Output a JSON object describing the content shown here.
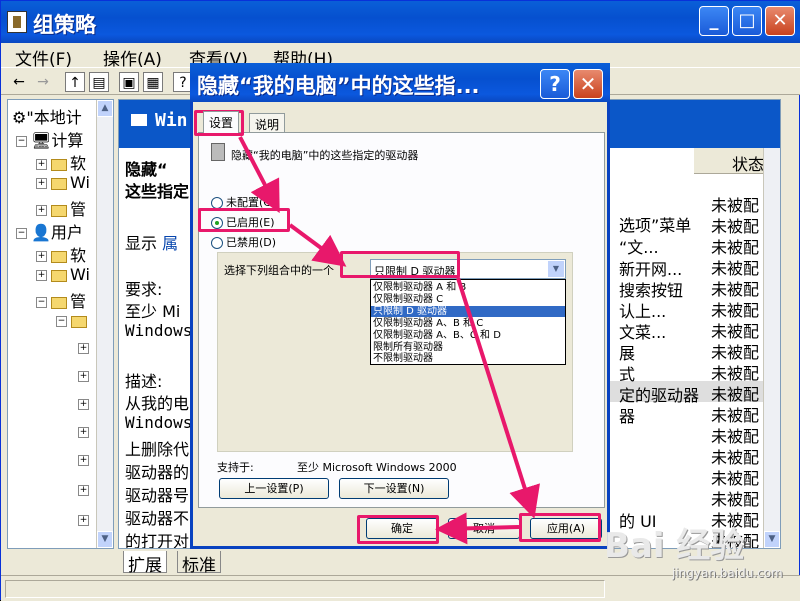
{
  "window": {
    "title": "组策略",
    "min": "_",
    "max": "□",
    "close": "✕"
  },
  "menu": [
    "文件(F)",
    "操作(A)",
    "查看(V)",
    "帮助(H)"
  ],
  "tree": {
    "rows": [
      "\"本地计",
      "计算",
      "软",
      "Wi",
      "管",
      "用户",
      "软",
      "Wi",
      "管"
    ]
  },
  "right": {
    "banner": "Win",
    "desc_title1": "隐藏“",
    "desc_title2": "这些指定",
    "show_prefix": "显示",
    "show_link": "属",
    "lines": [
      "要求:",
      "至少 Mi",
      "Windows",
      "",
      "描述:",
      "从我的电",
      "Windows",
      "上删除代",
      "驱动器的",
      "驱动器号",
      "驱动器不",
      "的打开对"
    ],
    "status_header": "状态",
    "items": [
      "选项”菜单",
      "“文...",
      "新开网...",
      "搜索按钮",
      "认上...",
      "文菜...",
      "展",
      "式",
      "定的驱动器",
      "器",
      "",
      "",
      "",
      "",
      "的 UI",
      ""
    ],
    "statuses": [
      "未被配",
      "未被配",
      "未被配",
      "未被配",
      "未被配",
      "未被配",
      "未被配",
      "未被配",
      "未被配",
      "未被配",
      "未被配",
      "未被配",
      "未被配",
      "未被配",
      "未被配",
      "未被配",
      "未被配"
    ]
  },
  "bottom_tabs": [
    "扩展",
    "标准"
  ],
  "dialog": {
    "title": "隐藏“我的电脑”中的这些指...",
    "help": "?",
    "close": "✕",
    "tabs": [
      "设置",
      "说明"
    ],
    "policy_name": "隐藏“我的电脑”中的这些指定的驱动器",
    "radios": [
      "未配置(C)",
      "已启用(E)",
      "已禁用(D)"
    ],
    "selected_radio": "已启用(E)",
    "combo_label": "选择下列组合中的一个",
    "combo_value": "只限制 D 驱动器",
    "options": [
      "仅限制驱动器 A 和 B",
      "仅限制驱动器 C",
      "只限制 D 驱动器",
      "仅限制驱动器 A、B 和 C",
      "仅限制驱动器 A、B、C 和 D",
      "限制所有驱动器",
      "不限制驱动器"
    ],
    "supported_label": "支持于:",
    "supported_value": "至少 Microsoft Windows 2000",
    "prev_button": "上一设置(P)",
    "next_button": "下一设置(N)",
    "ok_button": "确定",
    "cancel_button": "取消",
    "apply_button": "应用(A)"
  },
  "watermark": {
    "brand": "Bai 经验",
    "url": "jingyan.baidu.com"
  },
  "colors": {
    "xp_blue": "#0a5fd8",
    "annotation": "#e8186b"
  }
}
